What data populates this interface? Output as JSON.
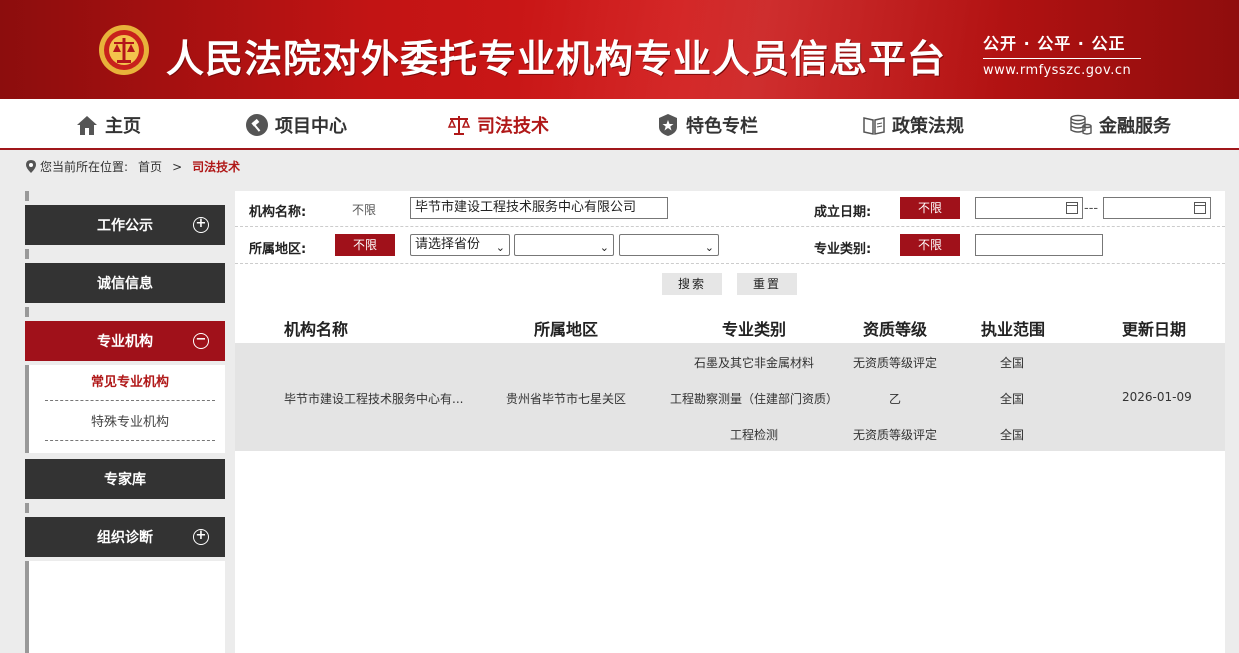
{
  "header": {
    "title": "人民法院对外委托专业机构专业人员信息平台",
    "slogan": "公开 · 公平 · 公正",
    "url": "www.rmfysszc.gov.cn"
  },
  "nav": {
    "items": [
      {
        "label": "主页",
        "icon": "home-icon"
      },
      {
        "label": "项目中心",
        "icon": "gavel-icon"
      },
      {
        "label": "司法技术",
        "icon": "scales-icon"
      },
      {
        "label": "特色专栏",
        "icon": "star-shield-icon"
      },
      {
        "label": "政策法规",
        "icon": "book-icon"
      },
      {
        "label": "金融服务",
        "icon": "coins-icon"
      }
    ],
    "active": "司法技术"
  },
  "breadcrumb": {
    "prefix": "您当前所在位置:",
    "home": "首页",
    "separator": ">",
    "current": "司法技术"
  },
  "sidebar": {
    "sections": [
      {
        "label": "工作公示",
        "toggle": "+"
      },
      {
        "label": "诚信信息",
        "toggle": ""
      },
      {
        "label": "专业机构",
        "toggle": "−"
      },
      {
        "label": "专家库",
        "toggle": ""
      },
      {
        "label": "组织诊断",
        "toggle": "+"
      }
    ],
    "sub_items": [
      {
        "label": "常见专业机构"
      },
      {
        "label": "特殊专业机构"
      }
    ]
  },
  "filters": {
    "org_name_label": "机构名称:",
    "org_name_unlimited": "不限",
    "org_name_value": "毕节市建设工程技术服务中心有限公司",
    "founded_label": "成立日期:",
    "founded_unlimited": "不限",
    "date_separator": "---",
    "region_label": "所属地区:",
    "region_unlimited": "不限",
    "province_select": "请选择省份",
    "city_select": "",
    "district_select": "",
    "category_label": "专业类别:",
    "category_unlimited": "不限",
    "category_value": ""
  },
  "buttons": {
    "search": "搜索",
    "reset": "重置"
  },
  "table": {
    "headers": [
      "机构名称",
      "所属地区",
      "专业类别",
      "资质等级",
      "执业范围",
      "更新日期"
    ],
    "row": {
      "name": "毕节市建设工程技术服务中心有...",
      "region": "贵州省毕节市七星关区",
      "date": "2026-01-09",
      "sub_rows": [
        {
          "category": "石墨及其它非金属材料",
          "grade": "无资质等级评定",
          "scope": "全国"
        },
        {
          "category": "工程勘察测量（住建部门资质）",
          "grade": "乙",
          "scope": "全国"
        },
        {
          "category": "工程检测",
          "grade": "无资质等级评定",
          "scope": "全国"
        }
      ]
    }
  },
  "colors": {
    "brand_red": "#a0111a",
    "dark_tab": "#333333"
  }
}
